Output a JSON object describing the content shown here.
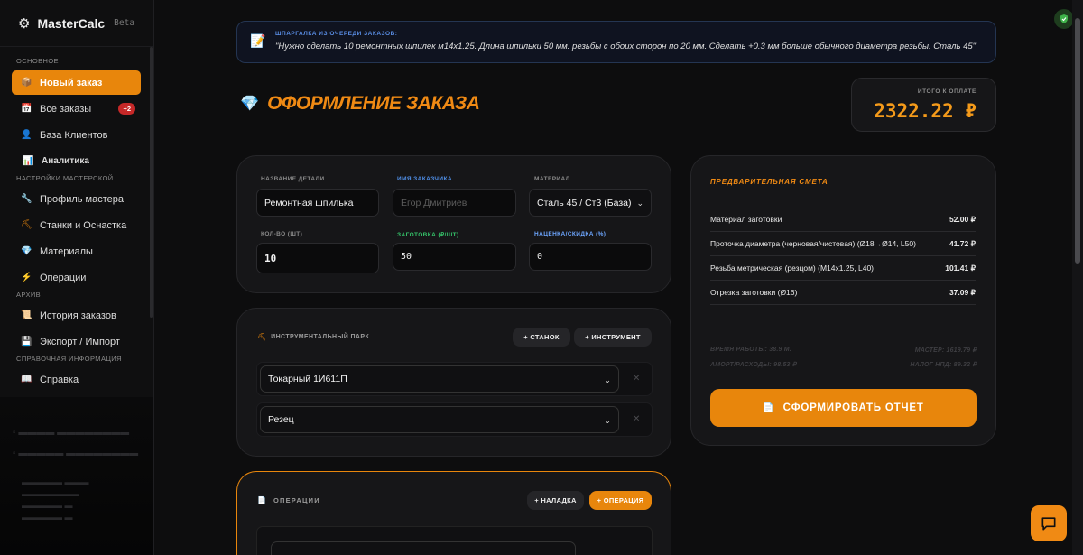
{
  "app": {
    "name": "MasterCalc",
    "beta": "Beta"
  },
  "sidebar": {
    "sec_main": "Основное",
    "sec_settings": "Настройки мастерской",
    "sec_archive": "Архив",
    "sec_ref": "Справочная информация",
    "items": [
      {
        "label": "Новый заказ",
        "icon": "box-icon",
        "glyph": "📦"
      },
      {
        "label": "Все заказы",
        "icon": "calendar-icon",
        "glyph": "📅",
        "badge": "+2"
      },
      {
        "label": "База Клиентов",
        "icon": "person-icon",
        "glyph": "👤"
      },
      {
        "label": "Аналитика",
        "icon": "chart-icon",
        "glyph": "📊"
      },
      {
        "label": "Профиль мастера",
        "icon": "wrench-icon",
        "glyph": "🔧"
      },
      {
        "label": "Станки и Оснастка",
        "icon": "tool-icon",
        "glyph": "⛏"
      },
      {
        "label": "Материалы",
        "icon": "gem-icon",
        "glyph": "💎"
      },
      {
        "label": "Операции",
        "icon": "lightning-icon",
        "glyph": "⚡"
      },
      {
        "label": "История заказов",
        "icon": "scroll-icon",
        "glyph": "📜"
      },
      {
        "label": "Экспорт / Импорт",
        "icon": "floppy-icon",
        "glyph": "💾"
      },
      {
        "label": "Справка",
        "icon": "book-icon",
        "glyph": "📖"
      }
    ]
  },
  "hint": {
    "title": "ШПАРГАЛКА ИЗ ОЧЕРЕДИ ЗАКАЗОВ:",
    "text": "\"Нужно сделать 10 ремонтных шпилек м14х1.25. Длина шпильки 50 мм. резьбы с обоих сторон по 20 мм. Сделать +0.3 мм больше обычного диаметра резьбы. Сталь 45\""
  },
  "page": {
    "title": "ОФОРМЛЕНИЕ ЗАКАЗА"
  },
  "total": {
    "label": "ИТОГО К ОПЛАТЕ",
    "value": "2322.22 ₽"
  },
  "form": {
    "part_label": "НАЗВАНИЕ ДЕТАЛИ",
    "part_value": "Ремонтная шпилька",
    "client_label": "ИМЯ ЗАКАЗЧИКА",
    "client_placeholder": "Егор Дмитриев",
    "material_label": "МАТЕРИАЛ",
    "material_value": "Сталь 45 / Ст3 (База)",
    "qty_label": "КОЛ-ВО (ШТ)",
    "qty_value": "10",
    "blank_label": "ЗАГОТОВКА (₽/ШТ)",
    "blank_value": "50",
    "markup_label": "НАЦЕНКА/СКИДКА (%)",
    "markup_value": "0"
  },
  "tools": {
    "title": "ИНСТРУМЕНТАЛЬНЫЙ ПАРК",
    "add_machine": "+ СТАНОК",
    "add_tool": "+ ИНСТРУМЕНТ",
    "machine": "Токарный 1И611П",
    "tool": "Резец"
  },
  "ops": {
    "title": "ОПЕРАЦИИ",
    "add_setup": "+ НАЛАДКА",
    "add_op": "+ ОПЕРАЦИЯ"
  },
  "estimate": {
    "title": "ПРЕДВАРИТЕЛЬНАЯ СМЕТА",
    "rows": [
      {
        "label": "Материал заготовки",
        "value": "52.00 ₽"
      },
      {
        "label": "Проточка диаметра (черновая/чистовая) (Ø18→Ø14, L50)",
        "value": "41.72 ₽"
      },
      {
        "label": "Резьба метрическая (резцом) (M14x1.25, L40)",
        "value": "101.41 ₽"
      },
      {
        "label": "Отрезка заготовки (Ø16)",
        "value": "37.09 ₽"
      }
    ],
    "work_time": "ВРЕМЯ РАБОТЫ: 38.9 М.",
    "master": "МАСТЕР: 1619.79 ₽",
    "amort": "АМОРТ/РАСХОДЫ: 98.53 ₽",
    "tax": "НАЛОГ НПД: 89.32 ₽",
    "report_btn": "СФОРМИРОВАТЬ ОТЧЕТ"
  }
}
